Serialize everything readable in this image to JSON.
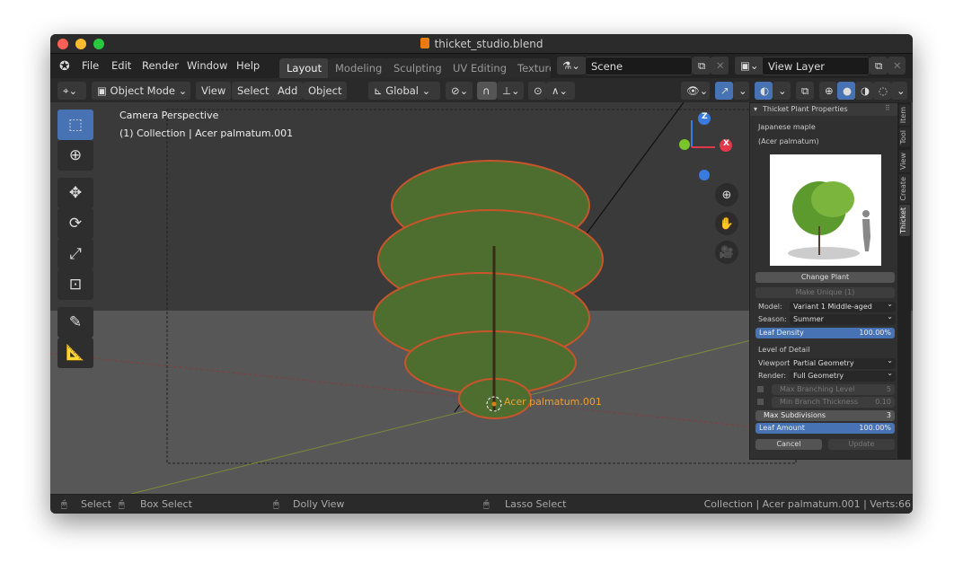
{
  "window": {
    "title": "thicket_studio.blend"
  },
  "menu": [
    "File",
    "Edit",
    "Render",
    "Window",
    "Help"
  ],
  "workspaces": [
    {
      "label": "Layout",
      "active": true
    },
    {
      "label": "Modeling"
    },
    {
      "label": "Sculpting"
    },
    {
      "label": "UV Editing"
    },
    {
      "label": "Texture"
    }
  ],
  "scene": {
    "value": "Scene"
  },
  "view_layer": {
    "value": "View Layer"
  },
  "header": {
    "mode": "Object Mode",
    "view": "View",
    "select": "Select",
    "add": "Add",
    "object": "Object",
    "orientation": "Global"
  },
  "viewport": {
    "camera_label": "Camera Perspective",
    "collection_label": "(1) Collection | Acer palmatum.001",
    "object_label": "Acer palmatum.001",
    "gizmo": {
      "z": "Z",
      "x": "X"
    }
  },
  "panel": {
    "title": "Thicket Plant Properties",
    "common_name": "Japanese maple",
    "latin_name": "(Acer palmatum)",
    "change_plant": "Change Plant",
    "make_unique": "Make Unique (1)",
    "model_label": "Model:",
    "model_value": "Variant 1 Middle-aged",
    "season_label": "Season:",
    "season_value": "Summer",
    "leaf_density_label": "Leaf Density",
    "leaf_density_value": "100.00%",
    "lod_label": "Level of Detail",
    "viewport_label": "Viewport:",
    "viewport_value": "Partial Geometry",
    "render_label": "Render:",
    "render_value": "Full Geometry",
    "max_branching_label": "Max Branching Level",
    "max_branching_value": "5",
    "min_branch_label": "Min Branch Thickness",
    "min_branch_value": "0.10",
    "max_subdiv_label": "Max Subdivisions",
    "max_subdiv_value": "3",
    "leaf_amount_label": "Leaf Amount",
    "leaf_amount_value": "100.00%",
    "cancel": "Cancel",
    "update": "Update"
  },
  "side_tabs": [
    "Item",
    "Tool",
    "View",
    "Create",
    "Thicket"
  ],
  "status": {
    "select": "Select",
    "box_select": "Box Select",
    "dolly": "Dolly View",
    "lasso": "Lasso Select",
    "info": "Collection | Acer palmatum.001 | Verts:66"
  },
  "colors": {
    "accent": "#4772b3",
    "selection": "#e87d0d"
  }
}
